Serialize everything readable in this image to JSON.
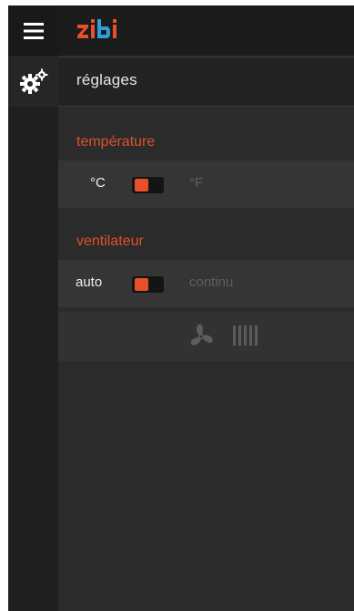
{
  "header": {
    "logo_text": "zibi",
    "menu_icon": "hamburger-menu-icon",
    "settings_icon": "gears-icon",
    "page_title": "réglages"
  },
  "temperature": {
    "section_title": "température",
    "left_label": "°C",
    "right_label": "°F",
    "selected": "°C"
  },
  "fan": {
    "section_title": "ventilateur",
    "left_label": "auto",
    "right_label": "continu",
    "selected": "auto",
    "speed_icon": "fan-icon",
    "speed_bars": 5
  },
  "colors": {
    "accent": "#e8502a",
    "logo_blue": "#2b9fd8",
    "background": "#2b2b2b"
  }
}
